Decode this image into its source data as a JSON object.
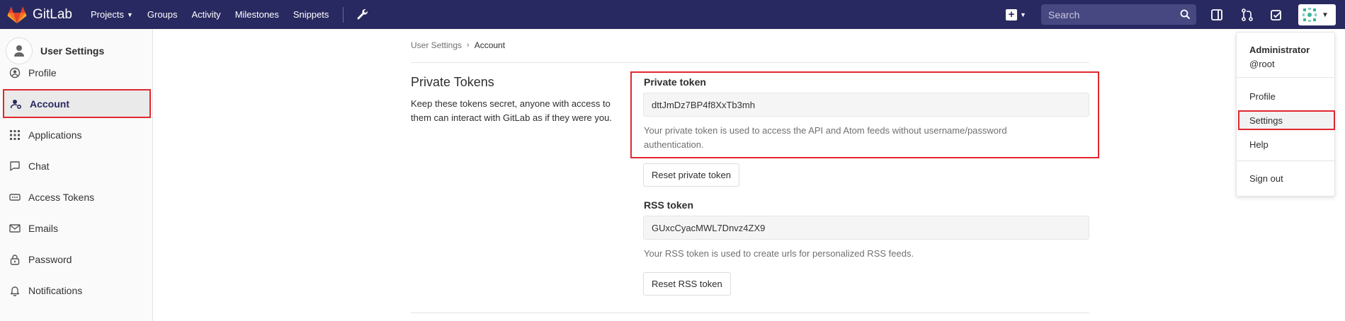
{
  "navbar": {
    "brand": "GitLab",
    "links": [
      {
        "label": "Projects",
        "dropdown": true
      },
      {
        "label": "Groups",
        "dropdown": false
      },
      {
        "label": "Activity",
        "dropdown": false
      },
      {
        "label": "Milestones",
        "dropdown": false
      },
      {
        "label": "Snippets",
        "dropdown": false
      }
    ],
    "search_placeholder": "Search",
    "colors": {
      "navbar_bg": "#292961",
      "search_bg": "#474782",
      "highlight": "#e0282f"
    }
  },
  "sidebar": {
    "title": "User Settings",
    "items": [
      {
        "label": "Profile",
        "icon": "user-circle-icon",
        "active": false
      },
      {
        "label": "Account",
        "icon": "user-gear-icon",
        "active": true
      },
      {
        "label": "Applications",
        "icon": "grid-icon",
        "active": false
      },
      {
        "label": "Chat",
        "icon": "chat-icon",
        "active": false
      },
      {
        "label": "Access Tokens",
        "icon": "token-icon",
        "active": false
      },
      {
        "label": "Emails",
        "icon": "envelope-icon",
        "active": false
      },
      {
        "label": "Password",
        "icon": "lock-icon",
        "active": false
      },
      {
        "label": "Notifications",
        "icon": "bell-icon",
        "active": false
      }
    ]
  },
  "breadcrumb": {
    "parent": "User Settings",
    "separator": "›",
    "current": "Account"
  },
  "section": {
    "title": "Private Tokens",
    "description": "Keep these tokens secret, anyone with access to them can interact with GitLab as if they were you."
  },
  "private_token": {
    "label": "Private token",
    "value": "dttJmDz7BP4f8XxTb3mh",
    "help": "Your private token is used to access the API and Atom feeds without username/password authentication.",
    "reset_label": "Reset private token"
  },
  "rss_token": {
    "label": "RSS token",
    "value": "GUxcCyacMWL7Dnvz4ZX9",
    "help": "Your RSS token is used to create urls for personalized RSS feeds.",
    "reset_label": "Reset RSS token"
  },
  "user_dropdown": {
    "name": "Administrator",
    "username": "@root",
    "items": [
      {
        "label": "Profile",
        "active": false
      },
      {
        "label": "Settings",
        "active": true
      },
      {
        "label": "Help",
        "active": false
      },
      {
        "label": "Sign out",
        "active": false
      }
    ]
  }
}
